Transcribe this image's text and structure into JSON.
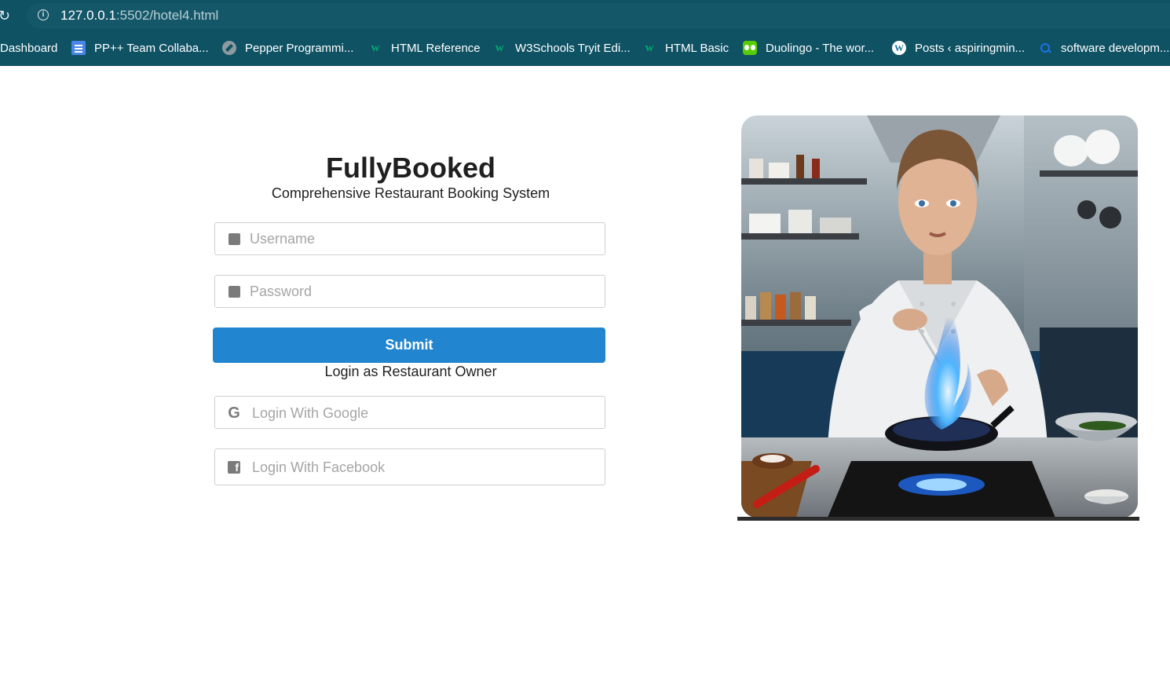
{
  "browser": {
    "url_host": "127.0.0.1",
    "url_path": ":5502/hotel4.html",
    "bookmarks": [
      {
        "label": "Dashboard",
        "icon": "none"
      },
      {
        "label": "PP++ Team Collaba...",
        "icon": "google-docs-icon"
      },
      {
        "label": "Pepper Programmi...",
        "icon": "compass-icon"
      },
      {
        "label": "HTML Reference",
        "icon": "w3schools-icon"
      },
      {
        "label": "W3Schools Tryit Edi...",
        "icon": "w3schools-icon"
      },
      {
        "label": "HTML Basic",
        "icon": "w3schools-icon"
      },
      {
        "label": "Duolingo - The wor...",
        "icon": "duolingo-icon"
      },
      {
        "label": "Posts ‹ aspiringmin...",
        "icon": "wordpress-icon"
      },
      {
        "label": "software developm...",
        "icon": "search-icon"
      }
    ]
  },
  "login": {
    "title": "FullyBooked",
    "subtitle": "Comprehensive Restaurant Booking System",
    "username_placeholder": "Username",
    "password_placeholder": "Password",
    "submit_label": "Submit",
    "owner_link": "Login as Restaurant Owner",
    "google_label": "Login With Google",
    "facebook_label": "Login With Facebook"
  },
  "colors": {
    "browser_chrome": "#0f5264",
    "submit_button": "#2185d0"
  }
}
